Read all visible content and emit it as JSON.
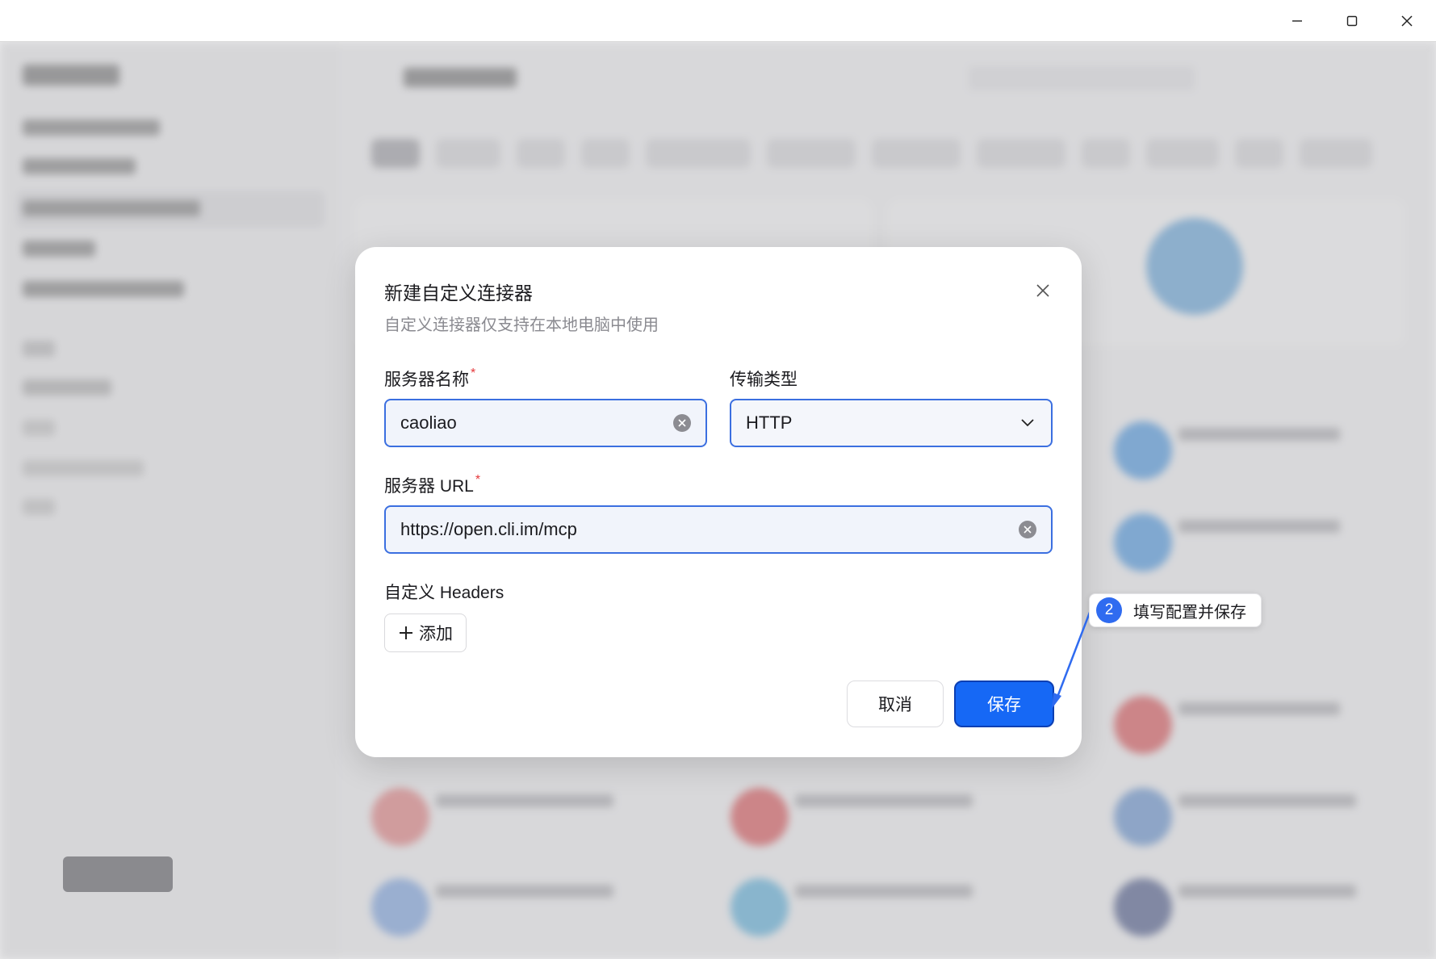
{
  "window": {
    "minimize_icon": "minimize-icon",
    "maximize_icon": "maximize-icon",
    "close_icon": "close-icon"
  },
  "modal": {
    "title": "新建自定义连接器",
    "subtitle": "自定义连接器仅支持在本地电脑中使用",
    "server_name": {
      "label": "服务器名称",
      "required_mark": "*",
      "value": "caoliao"
    },
    "transport": {
      "label": "传输类型",
      "value": "HTTP"
    },
    "server_url": {
      "label": "服务器 URL",
      "required_mark": "*",
      "value": "https://open.cli.im/mcp"
    },
    "headers": {
      "label": "自定义 Headers",
      "add_label": "添加"
    },
    "cancel_label": "取消",
    "save_label": "保存"
  },
  "annotation": {
    "step": "2",
    "text": "填写配置并保存"
  },
  "colors": {
    "primary": "#1668f5",
    "focus_border": "#3b6fe0",
    "required": "#e5393c",
    "annotation_badge": "#2f6bf0"
  }
}
